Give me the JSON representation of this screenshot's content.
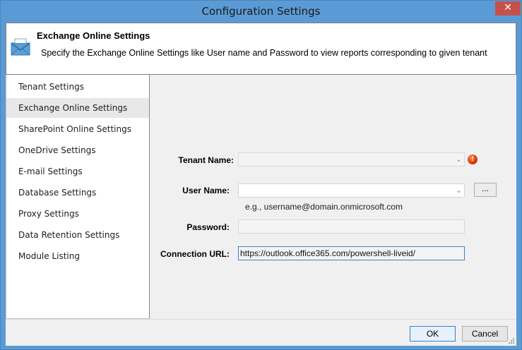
{
  "window": {
    "title": "Configuration Settings",
    "close_glyph": "✕"
  },
  "header": {
    "title": "Exchange Online Settings",
    "description": "Specify the Exchange Online Settings like User name and Password to view reports corresponding to given tenant",
    "icon": "mail-icon"
  },
  "sidebar": {
    "items": [
      {
        "label": "Tenant Settings",
        "active": false
      },
      {
        "label": "Exchange Online Settings",
        "active": true
      },
      {
        "label": "SharePoint Online Settings",
        "active": false
      },
      {
        "label": "OneDrive Settings",
        "active": false
      },
      {
        "label": "E-mail Settings",
        "active": false
      },
      {
        "label": "Database Settings",
        "active": false
      },
      {
        "label": "Proxy Settings",
        "active": false
      },
      {
        "label": "Data Retention Settings",
        "active": false
      },
      {
        "label": "Module Listing",
        "active": false
      }
    ]
  },
  "form": {
    "tenant_name_label": "Tenant Name:",
    "tenant_name_value": "",
    "user_name_label": "User Name:",
    "user_name_value": "",
    "user_name_hint": "e.g., username@domain.onmicrosoft.com",
    "browse_label": "...",
    "password_label": "Password:",
    "password_value": "",
    "connection_url_label": "Connection URL:",
    "connection_url_value": "https://outlook.office365.com/powershell-liveid/",
    "error_glyph": "!"
  },
  "footer": {
    "ok_label": "OK",
    "cancel_label": "Cancel"
  },
  "colors": {
    "titlebar": "#5b9bd5",
    "close_button": "#c7504a",
    "focus_border": "#3c7fd1",
    "error": "#d22b00"
  }
}
